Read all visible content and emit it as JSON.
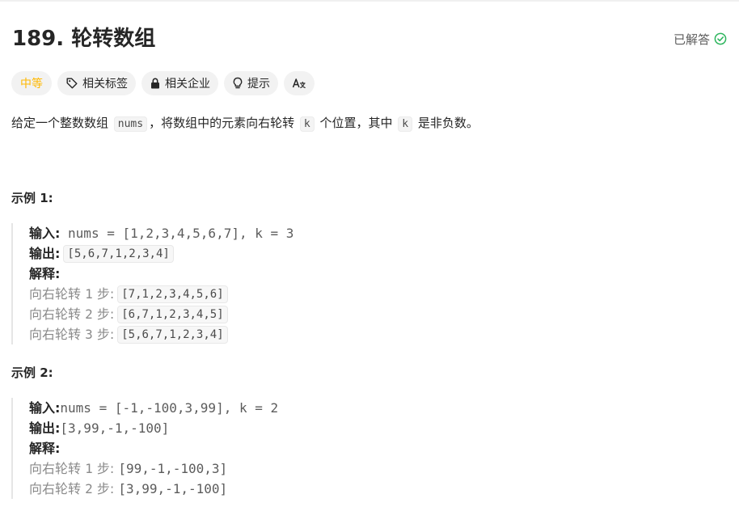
{
  "problem": {
    "title": "189. 轮转数组",
    "status": "已解答"
  },
  "tags": {
    "difficulty": "中等",
    "related_topics": "相关标签",
    "related_companies": "相关企业",
    "hint": "提示"
  },
  "description": {
    "part1": "给定一个整数数组 ",
    "code_nums": "nums",
    "part2": "，将数组中的元素向右轮转 ",
    "code_k1": "k",
    "part3": " 个位置，其中 ",
    "code_k2": "k",
    "part4": " 是非负数。"
  },
  "example1": {
    "title": "示例 1:",
    "input_label": "输入:",
    "input_value": " nums = [1,2,3,4,5,6,7], k = 3",
    "output_label": "输出:",
    "output_value": "[5,6,7,1,2,3,4]",
    "explain_label": "解释:",
    "steps": [
      {
        "prefix": "向右轮转 ",
        "num": "1",
        "suffix": " 步:",
        "value": "[7,1,2,3,4,5,6]"
      },
      {
        "prefix": "向右轮转 ",
        "num": "2",
        "suffix": " 步:",
        "value": "[6,7,1,2,3,4,5]"
      },
      {
        "prefix": "向右轮转 ",
        "num": "3",
        "suffix": " 步:",
        "value": "[5,6,7,1,2,3,4]"
      }
    ]
  },
  "example2": {
    "title": "示例 2:",
    "input_label": "输入:",
    "input_value": "nums = [-1,-100,3,99], k = 2",
    "output_label": "输出:",
    "output_value": "[3,99,-1,-100]",
    "explain_label": "解释:",
    "steps": [
      {
        "prefix": "向右轮转 ",
        "num": "1",
        "suffix": " 步: ",
        "value": "[99,-1,-100,3]"
      },
      {
        "prefix": "向右轮转 ",
        "num": "2",
        "suffix": " 步: ",
        "value": "[3,99,-1,-100]"
      }
    ]
  },
  "colors": {
    "difficulty_medium": "#ffb800",
    "solved_check": "#2db55d"
  },
  "icons": {
    "solved": "check-circle-icon",
    "topics": "tag-icon",
    "companies": "lock-icon",
    "hint": "lightbulb-icon",
    "translate": "translate-icon"
  }
}
